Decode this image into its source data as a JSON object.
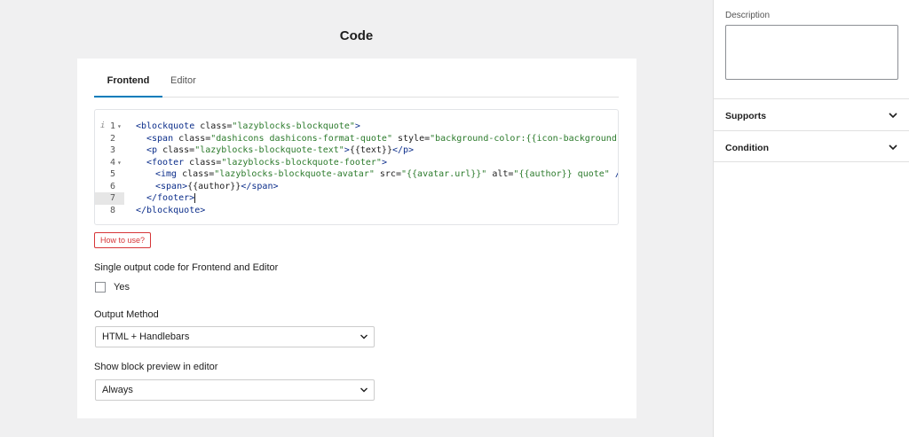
{
  "main": {
    "title": "Code",
    "tabs": [
      {
        "label": "Frontend",
        "active": true
      },
      {
        "label": "Editor",
        "active": false
      }
    ],
    "code_lines": [
      {
        "num": "1",
        "fold": "▾",
        "info": "i"
      },
      {
        "num": "2"
      },
      {
        "num": "3"
      },
      {
        "num": "4",
        "fold": "▾"
      },
      {
        "num": "5"
      },
      {
        "num": "6"
      },
      {
        "num": "7",
        "active": true
      },
      {
        "num": "8"
      }
    ],
    "how_to_use_label": "How to use?",
    "single_output_label": "Single output code for Frontend and Editor",
    "single_output_checkbox_label": "Yes",
    "output_method_label": "Output Method",
    "output_method_value": "HTML + Handlebars",
    "preview_label": "Show block preview in editor",
    "preview_value": "Always"
  },
  "code": {
    "l1": {
      "t1": "<blockquote",
      "a1": " class=",
      "s1": "\"lazyblocks-blockquote\"",
      "t2": ">"
    },
    "l2": {
      "t1": "<span",
      "a1": " class=",
      "s1": "\"dashicons dashicons-format-quote\"",
      "a2": " style=",
      "s2": "\"background-color:{{icon-background}};\"",
      "t2": "><"
    },
    "l3": {
      "t1": "<p",
      "a1": " class=",
      "s1": "\"lazyblocks-blockquote-text\"",
      "t2": ">",
      "x": "{{text}}",
      "t3": "</p>"
    },
    "l4": {
      "t1": "<footer",
      "a1": " class=",
      "s1": "\"lazyblocks-blockquote-footer\"",
      "t2": ">"
    },
    "l5": {
      "t1": "<img",
      "a1": " class=",
      "s1": "\"lazyblocks-blockquote-avatar\"",
      "a2": " src=",
      "s2": "\"{{avatar.url}}\"",
      "a3": " alt=",
      "s3": "\"{{author}} quote\"",
      "t2": " />"
    },
    "l6": {
      "t1": "<span>",
      "x": "{{author}}",
      "t2": "</span>"
    },
    "l7": {
      "t1": "</footer>"
    },
    "l8": {
      "t1": "</blockquote>"
    }
  },
  "sidebar": {
    "description_label": "Description",
    "description_value": "",
    "panels": [
      {
        "title": "Supports"
      },
      {
        "title": "Condition"
      }
    ]
  },
  "colors": {
    "accent": "#007cba",
    "danger": "#d63638",
    "tag": "#0b2d8a",
    "string": "#2b7a2b"
  },
  "icons": {
    "select_chevron": "chevron-down-icon",
    "panel_chevron": "chevron-down-icon",
    "fold_marker": "caret-down-icon"
  }
}
